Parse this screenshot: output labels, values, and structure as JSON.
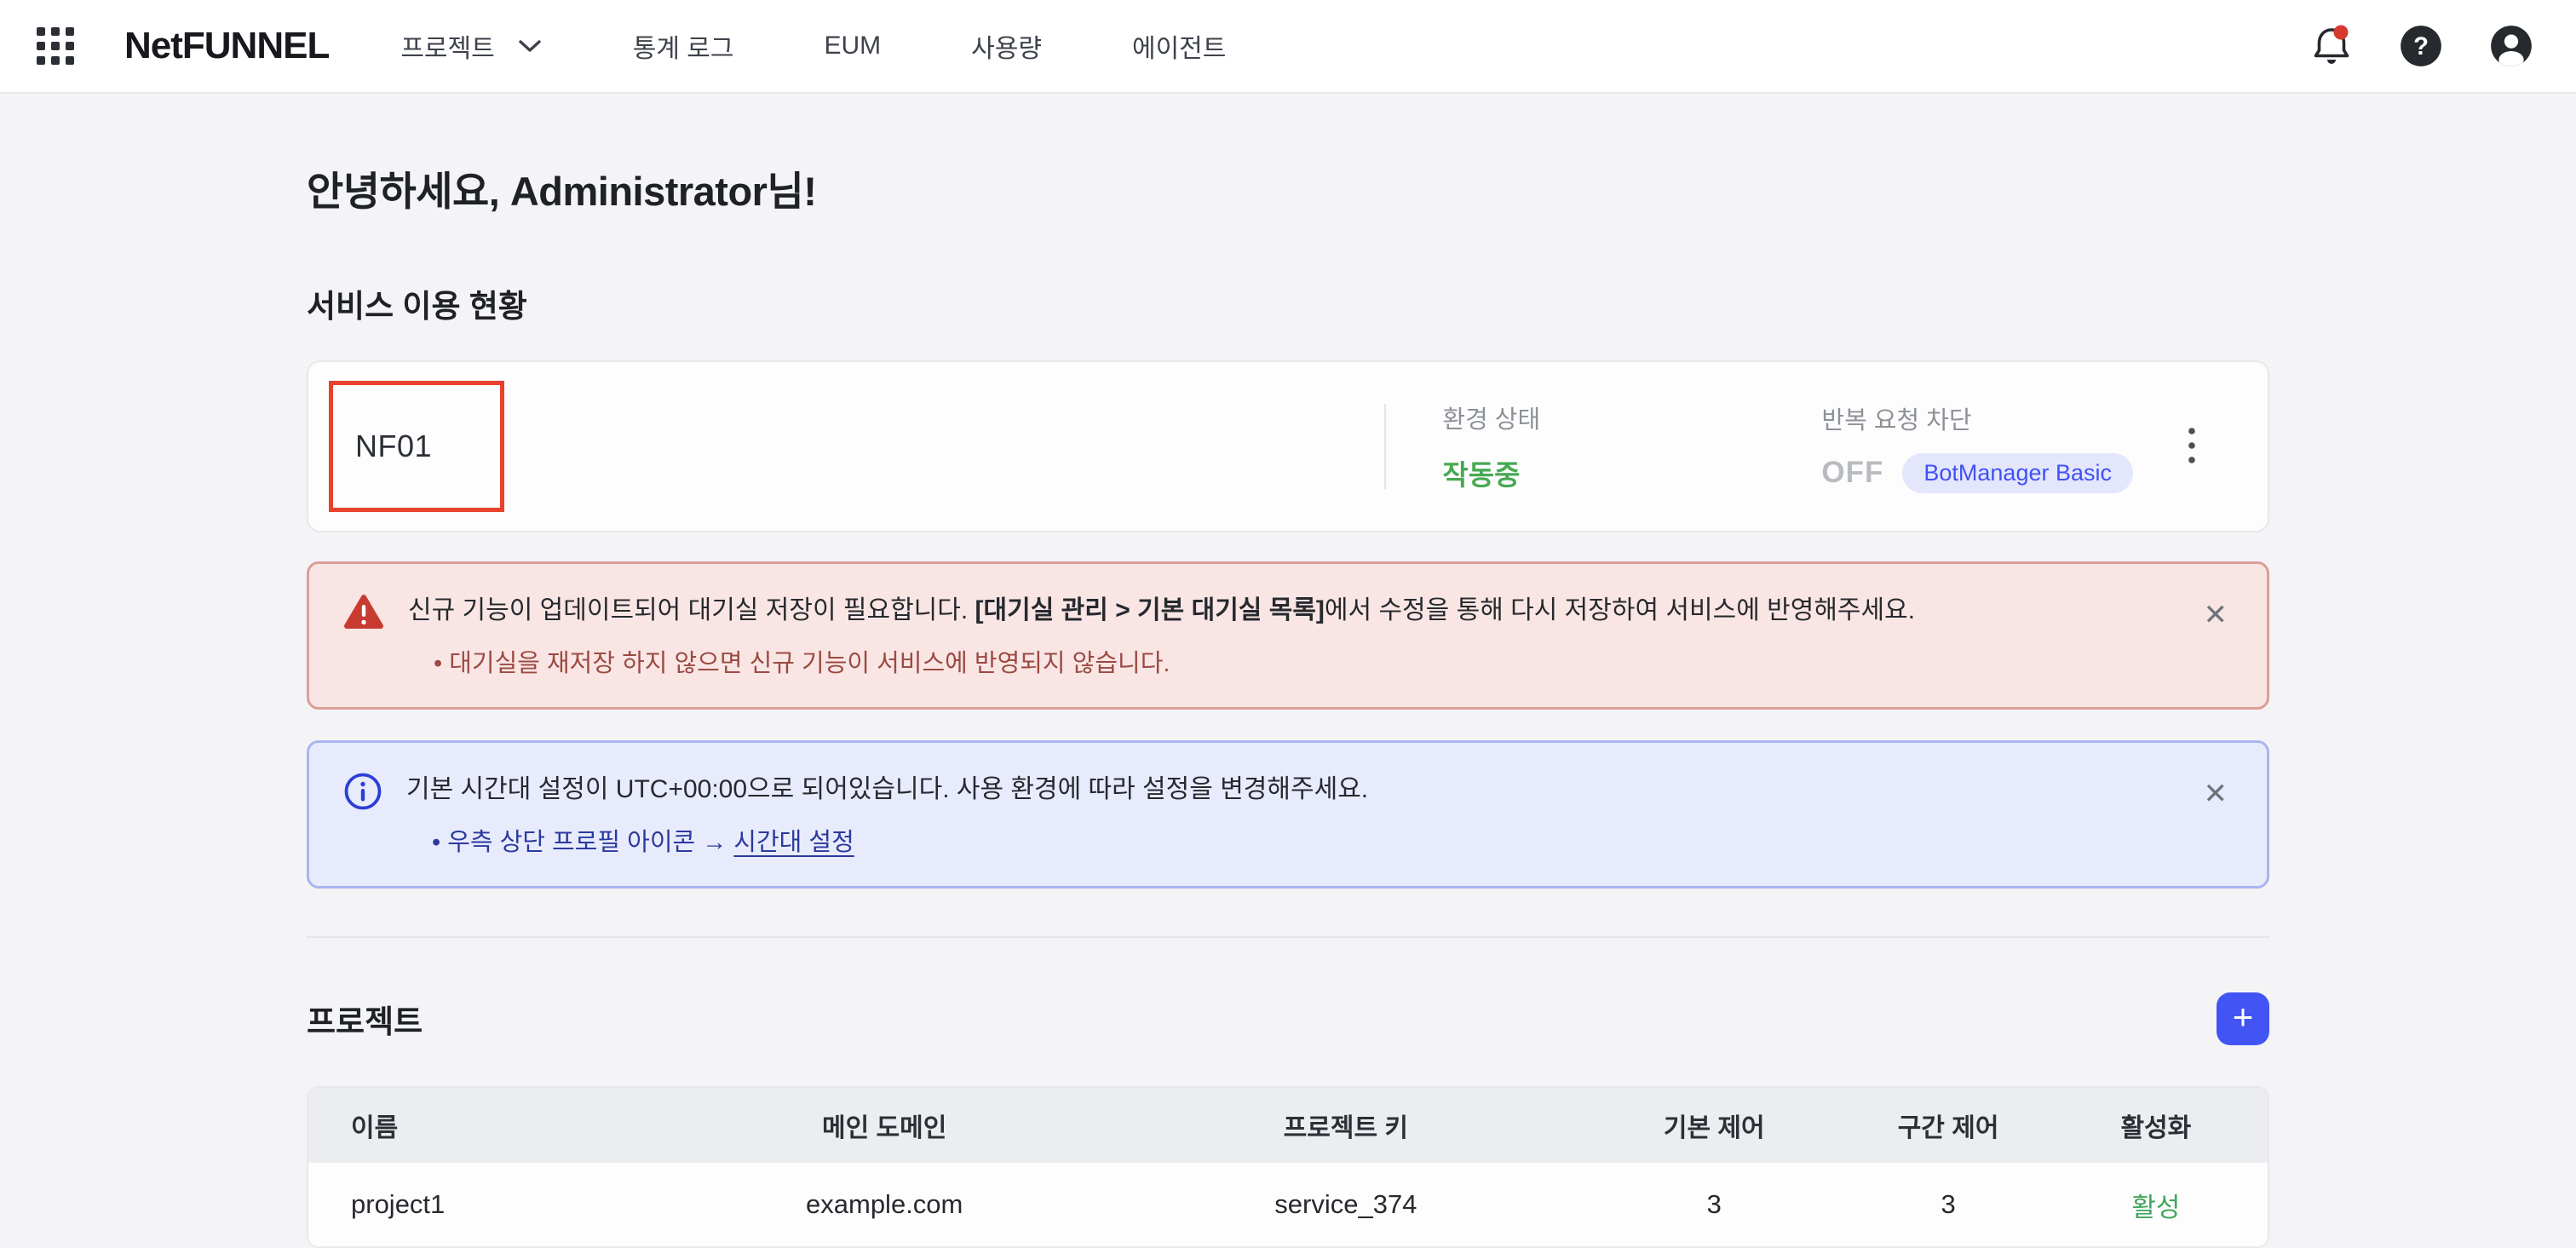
{
  "header": {
    "logo": "NetFUNNEL",
    "nav": [
      {
        "label": "프로젝트"
      },
      {
        "label": "통계 로그"
      },
      {
        "label": "EUM"
      },
      {
        "label": "사용량"
      },
      {
        "label": "에이전트"
      }
    ]
  },
  "icons": {
    "help": "?",
    "close": "✕"
  },
  "greeting": "안녕하세요, Administrator님!",
  "service": {
    "title": "서비스 이용 현황",
    "card": {
      "name": "NF01",
      "env_label": "환경 상태",
      "env_value": "작동중",
      "block_label": "반복 요청 차단",
      "block_value": "OFF",
      "badge": "BotManager Basic"
    }
  },
  "warning_banner": {
    "text_before": "신규 기능이 업데이트되어 대기실 저장이 필요합니다. ",
    "text_bold": "[대기실 관리 > 기본 대기실 목록]",
    "text_after": "에서 수정을 통해 다시 저장하여 서비스에 반영해주세요.",
    "bullet": "•  대기실을 재저장 하지 않으면 신규 기능이 서비스에 반영되지 않습니다."
  },
  "info_banner": {
    "text": "기본 시간대 설정이 UTC+00:00으로 되어있습니다. 사용 환경에 따라 설정을 변경해주세요.",
    "bullet_prefix": "•  우측 상단 프로필 아이콘 → ",
    "bullet_link": "시간대 설정"
  },
  "projects": {
    "title": "프로젝트",
    "add_button": "+",
    "table": {
      "headers": [
        "이름",
        "메인 도메인",
        "프로젝트 키",
        "기본 제어",
        "구간 제어",
        "활성화"
      ],
      "rows": [
        {
          "name": "project1",
          "domain": "example.com",
          "key": "service_374",
          "basic_control": "3",
          "section_control": "3",
          "active": "활성"
        }
      ]
    }
  },
  "colors": {
    "accent_blue": "#4255f4",
    "badge_text_blue": "#4150f5",
    "badge_bg": "#e4e7fc",
    "status_green": "#47a952",
    "active_green": "#41a65c",
    "highlight_red": "#e8422c",
    "warning_bg": "#f9e6e4",
    "info_bg": "#e8ebfc",
    "notification_red": "#d63a2f"
  }
}
